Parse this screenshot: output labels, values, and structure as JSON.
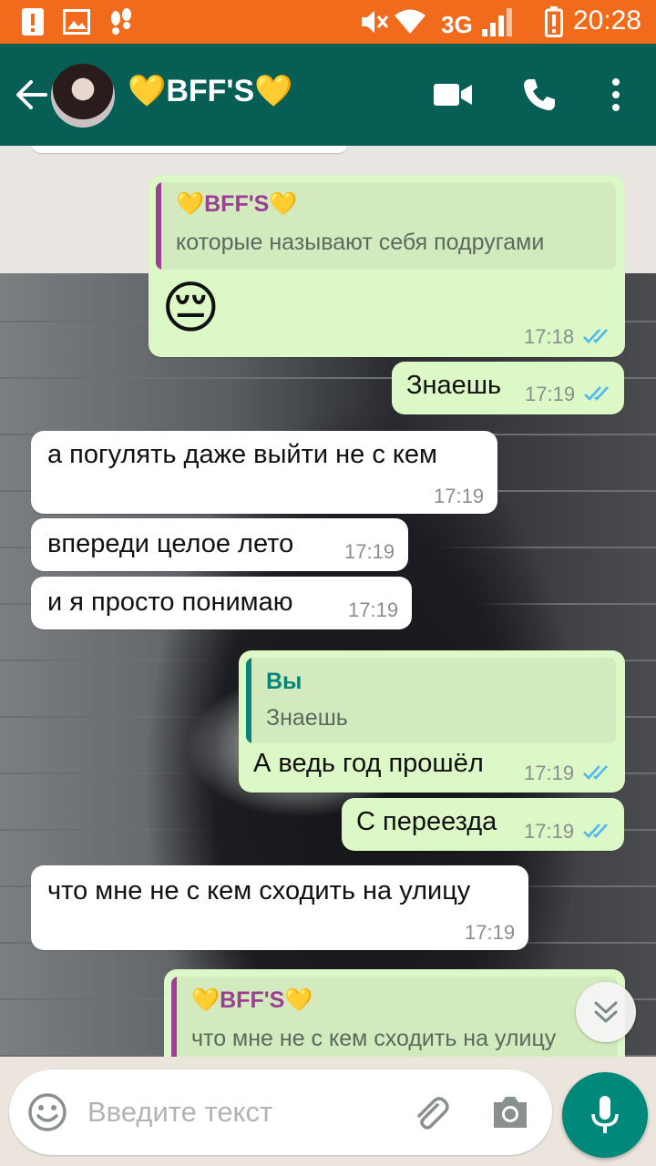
{
  "status_bar": {
    "time": "20:28",
    "network": "3G",
    "icons": [
      "alert-icon",
      "image-icon",
      "footsteps-icon",
      "mute-icon",
      "wifi-icon",
      "signal-icon",
      "battery-low-icon"
    ]
  },
  "header": {
    "contact_name": "💛BFF'S💛",
    "back_icon": "arrow-left-icon",
    "actions": [
      "video-call-icon",
      "phone-icon",
      "more-vert-icon"
    ]
  },
  "messages": [
    {
      "dir": "out",
      "quote": {
        "author": "💛BFF'S💛",
        "text": "которые называют себя подругами"
      },
      "text": "😔",
      "time": "17:18",
      "read": true
    },
    {
      "dir": "out",
      "text": "Знаешь",
      "time": "17:19",
      "read": true
    },
    {
      "dir": "in",
      "text": "а погулять даже выйти не с кем",
      "time": "17:19"
    },
    {
      "dir": "in",
      "text": "впереди целое лето",
      "time": "17:19"
    },
    {
      "dir": "in",
      "text": "и я просто понимаю",
      "time": "17:19"
    },
    {
      "dir": "out",
      "quote": {
        "author": "Вы",
        "text": "Знаешь"
      },
      "text": "А ведь год прошёл",
      "time": "17:19",
      "read": true
    },
    {
      "dir": "out",
      "text": "С переезда",
      "time": "17:19",
      "read": true
    },
    {
      "dir": "in",
      "text": "что мне не с кем сходить на улицу",
      "time": "17:19"
    },
    {
      "dir": "out",
      "quote": {
        "author": "💛BFF'S💛",
        "text": "что мне не с кем сходить на улицу"
      },
      "text": "",
      "time": "",
      "read": false
    }
  ],
  "input": {
    "placeholder": "Введите текст",
    "icons": [
      "emoji-icon",
      "attach-icon",
      "camera-icon",
      "mic-icon"
    ]
  },
  "colors": {
    "status_bar": "#f26b1d",
    "app_bar": "#075e54",
    "outgoing_bubble": "#dcf8c6",
    "incoming_bubble": "#ffffff",
    "read_ticks": "#4fb7ec",
    "quote_author_group": "#9c3f94",
    "quote_author_you": "#06847a",
    "mic_button": "#00897b"
  }
}
